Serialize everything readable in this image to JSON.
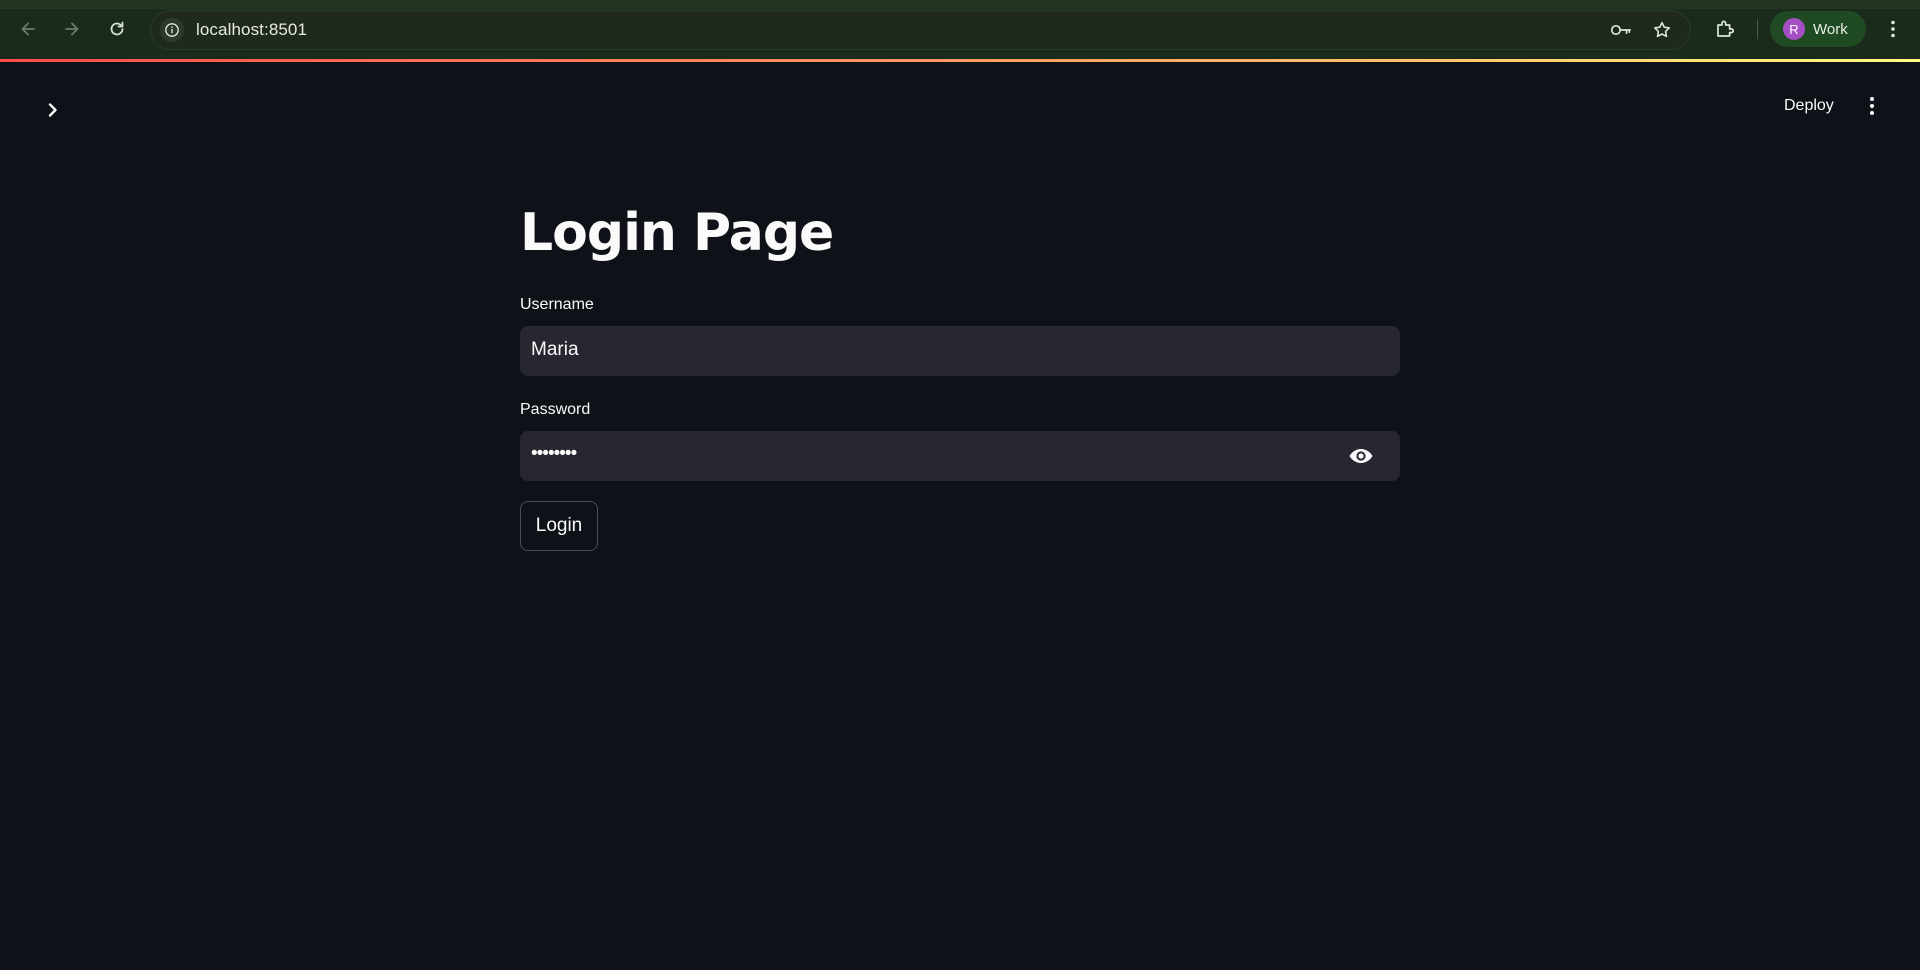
{
  "browser": {
    "url": "localhost:8501",
    "profile": {
      "initial": "R",
      "label": "Work",
      "avatar_color": "#a64fc4"
    },
    "icons": {
      "back": "arrow-left-icon",
      "forward": "arrow-right-icon",
      "reload": "reload-icon",
      "site_info": "info-icon",
      "password": "key-icon",
      "bookmark": "star-icon",
      "extensions": "puzzle-icon",
      "menu": "kebab-menu-icon"
    }
  },
  "app": {
    "deploy_label": "Deploy",
    "accent_gradient": [
      "#ff4b4b",
      "#fffd80"
    ],
    "background": "#0e1117"
  },
  "main": {
    "title": "Login Page",
    "username": {
      "label": "Username",
      "value": "Maria"
    },
    "password": {
      "label": "Password",
      "masked_value": "••••••••"
    },
    "login_label": "Login"
  }
}
